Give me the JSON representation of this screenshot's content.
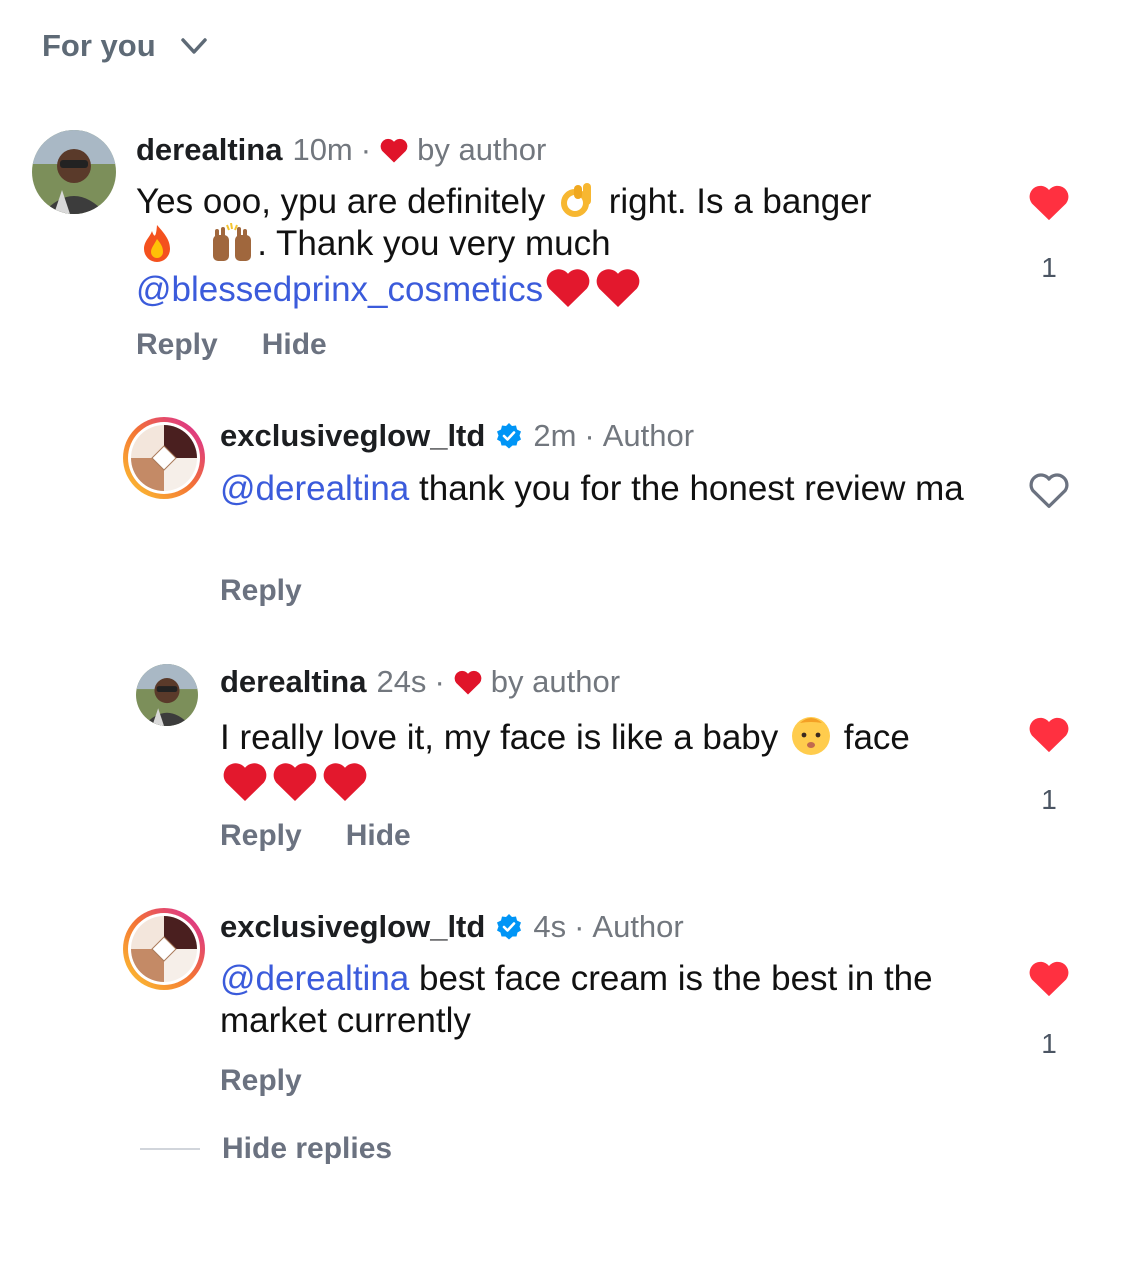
{
  "filter": {
    "label": "For you"
  },
  "comments": [
    {
      "username": "derealtina",
      "time": "10m",
      "sep": "·",
      "badge": "by author",
      "text_parts": [
        "Yes ooo, ypu are definitely ",
        " right.  Is a banger",
        ". Thank you very much"
      ],
      "mention": "@blessedprinx_cosmetics",
      "reply": "Reply",
      "hide": "Hide",
      "likes": "1",
      "liked": true
    },
    {
      "username": "exclusiveglow_ltd",
      "time": "2m",
      "sep": "·",
      "badge": "Author",
      "mention": "@derealtina",
      "text": "thank you for the honest review ma",
      "reply": "Reply",
      "liked": false
    },
    {
      "username": "derealtina",
      "time": "24s",
      "sep": "·",
      "badge": "by author",
      "text_parts": [
        "I really love it, my face is like a baby ",
        " face"
      ],
      "reply": "Reply",
      "hide": "Hide",
      "likes": "1",
      "liked": true
    },
    {
      "username": "exclusiveglow_ltd",
      "time": "4s",
      "sep": "·",
      "badge": "Author",
      "mention": "@derealtina",
      "text": "best face cream is the best in the market currently",
      "reply": "Reply",
      "likes": "1",
      "liked": true
    }
  ],
  "hide_replies": "Hide replies",
  "colors": {
    "like_red": "#ff3040",
    "mention_blue": "#3b5bdb",
    "verified_blue": "#0095f6"
  }
}
